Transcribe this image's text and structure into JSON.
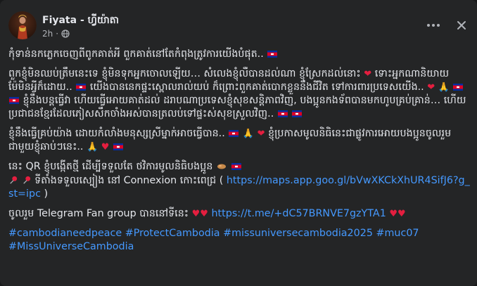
{
  "post": {
    "author": "Fiyata - ហ្វីយ៉ាតា",
    "time": "2h",
    "separator": "·",
    "icons": {
      "avatar": "profile-photo",
      "privacy": "globe-icon",
      "more": "more-horizontal-icon",
      "close": "close-icon",
      "flag": "cambodia-flag-icon",
      "heart": "red-heart-icon",
      "pray": "folded-hands-icon",
      "pin": "round-pushpin-icon",
      "bullet": "wooden-bullet-icon"
    },
    "colors": {
      "background": "#242526",
      "text": "#e4e6eb",
      "muted": "#b0b3b8",
      "link": "#4599ff",
      "heart": "#e41e3f"
    },
    "paragraphs": {
      "p1": "កុំទាន់នកភ្លេកចេញពីពូកគាត់អី ពួកគាត់នៅតែកំពុងត្រូវការយើងបំផុត..",
      "p2a": "ពួកខ្ញុំមិនឈប់ត្រឹមនេះទេ ខ្ញុំមិនទុកអ្នកចោលឡើយ… សំលេងខ្ញុំលឺបានដល់ណា ខ្ញុំស្រែកដល់នោះ",
      "p2b": "ទោះអ្នកណានិយាយម៉ែមិនអ្វីក៏ដោយ..",
      "p2c": "យើងបាននេកផ្ទះស្ពោលរាល់យប់ ក៏ព្រោះពួកគាត់បោកខ្លួននឹងជីវិត ទៅការពារប្រទេសយើង..",
      "p2d": "ខ្ញុំនឹងបន្តធ្វើវា ហើយធ្វើអោយគាត់ដល់ ដរាបណាប្រទេសខ្ញុំសុខសន្តិភាពវិញ, បងប្អូនកងទ័ពបានមកហូបគ្រប់គ្រាន់… ហើយប្រជាជនខ្មែរដែលភៀសសឹកចាំងអស់បានត្រលប់ទៅផ្ទះស់សុខស្រួលវិញ..",
      "p3a": "ខ្ញុំនឹងធ្វើគ្រប់យ៉ាង ដោយកំលាំងមនុស្សស្រីម្នាក់អាចធ្វើបាន..",
      "p3b": "ខ្ញុំប្រកាសមូលនិធិនេះជាផ្លូវការអោយបងប្អូនចូលរួម ជាមួយខ្ញុំឆាប់ៗនេះ..",
      "p4": "នេះ QR ខ្ញុំបង្កើតថ្មី ដើម្បីទទួលតែ ថវិការមូលនិធិបងប្អូន",
      "p5": "ទីតាំងទទួលស្បៀង នៅ Connexion កោះពេជ្រ (",
      "p5_link": "https://maps.app.goo.gl/bVwXKCkXhUR4SifJ6?g_st=ipc",
      "p5_close": ")",
      "p6": "ចូលរួម Telegram Fan group បាននៅទីនេះ",
      "p6_link": "https://t.me/+dC57BRNVE7gzYTA1"
    },
    "hashtags": [
      "#cambodianeedpeace",
      "#ProtectCambodia",
      "#missuniversecambodia2025",
      "#muc07",
      "#MissUniverseCambodia"
    ]
  }
}
